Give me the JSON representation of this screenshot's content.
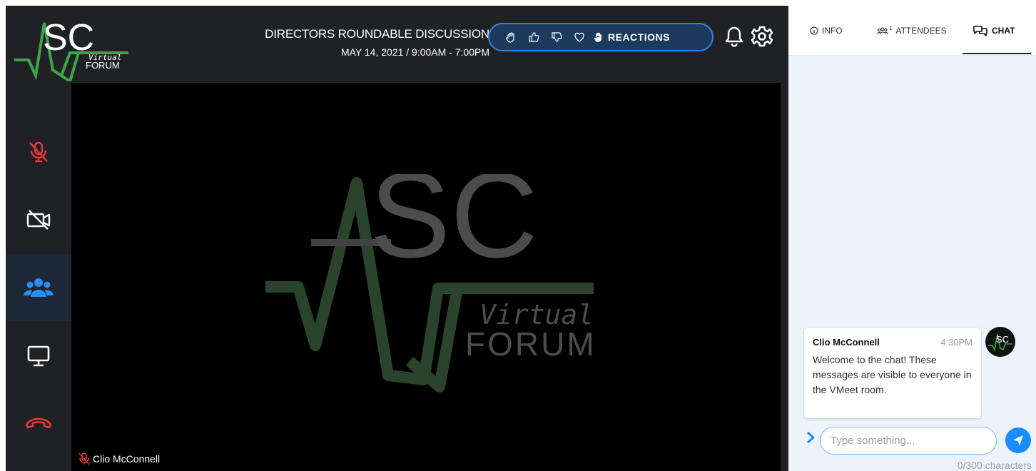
{
  "header": {
    "event_title": "DIRECTORS ROUNDABLE DISCUSSION",
    "event_datetime": "MAY 14, 2021 / 9:00AM - 7:00PM",
    "reactions_label": "REACTIONS",
    "reaction_icons": [
      "raise-hand-icon",
      "thumbs-up-icon",
      "thumbs-down-icon",
      "heart-icon",
      "hand-icon"
    ]
  },
  "logo": {
    "letters": "SC",
    "virtual": "Virtual",
    "forum": "FORUM",
    "brand_color": "#3aa64a"
  },
  "sidebar": {
    "buttons": [
      {
        "name": "mic-muted-button",
        "icon": "microphone-off-icon",
        "color": "#e53935"
      },
      {
        "name": "camera-off-button",
        "icon": "camera-off-icon",
        "color": "#ffffff"
      },
      {
        "name": "participants-button",
        "icon": "users-icon",
        "color": "#2d8cf0",
        "active": true
      },
      {
        "name": "share-screen-button",
        "icon": "monitor-icon",
        "color": "#ffffff"
      },
      {
        "name": "hang-up-button",
        "icon": "phone-hangup-icon",
        "color": "#e53935"
      }
    ]
  },
  "video": {
    "participant_name": "Clio McConnell"
  },
  "panel": {
    "tabs": [
      {
        "label": "INFO",
        "icon": "info-icon"
      },
      {
        "label": "ATTENDEES",
        "icon": "attendees-icon",
        "count": "1"
      },
      {
        "label": "CHAT",
        "icon": "chat-icon",
        "active": true
      }
    ],
    "message": {
      "author": "Clio McConnell",
      "time": "4:30PM",
      "text": "Welcome to the chat! These messages are visible to everyone in the VMeet room."
    },
    "input_placeholder": "Type something...",
    "char_counter": "0/300 characters"
  }
}
